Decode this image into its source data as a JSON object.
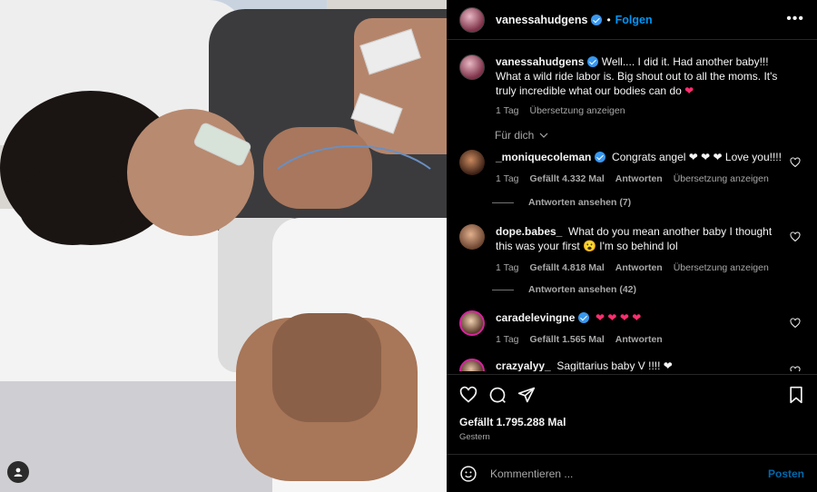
{
  "post": {
    "username": "vanessahudgens",
    "follow_label": "Folgen",
    "separator": "•",
    "more_label": "•••",
    "caption_text": "Well.... I did it. Had another baby!!! What a wild ride labor is. Big shout out to all the moms. It's truly incredible what our bodies can do",
    "caption_emoji": "❤",
    "caption_time": "1 Tag",
    "caption_translate": "Übersetzung anzeigen",
    "for_you_label": "Für dich",
    "likes": "Gefällt 1.795.288 Mal",
    "date": "Gestern"
  },
  "comments": [
    {
      "username": "_moniquecoleman",
      "verified": true,
      "text": "Congrats angel ❤ ❤ ❤ Love you!!!!",
      "time": "1 Tag",
      "likes": "Gefällt 4.332 Mal",
      "reply": "Antworten",
      "translate": "Übersetzung anzeigen",
      "view_replies": "Antworten ansehen (7)"
    },
    {
      "username": "dope.babes_",
      "verified": false,
      "text": "What do you mean another baby I thought this was your first 😮 I'm so behind lol",
      "time": "1 Tag",
      "likes": "Gefällt 4.818 Mal",
      "reply": "Antworten",
      "translate": "Übersetzung anzeigen",
      "view_replies": "Antworten ansehen (42)"
    },
    {
      "username": "caradelevingne",
      "verified": true,
      "text": "❤ ❤ ❤ ❤",
      "time": "1 Tag",
      "likes": "Gefällt 1.565 Mal",
      "reply": "Antworten"
    },
    {
      "username": "crazyalyy_",
      "verified": false,
      "text": "Sagittarius baby V !!!! ❤"
    }
  ],
  "composer": {
    "placeholder": "Kommentieren ...",
    "post_label": "Posten"
  },
  "colors": {
    "accent": "#0095f6",
    "background": "#000000",
    "secondary_text": "#a8a8a8",
    "heart": "#ff2d6f",
    "verified": "#3897f0"
  }
}
